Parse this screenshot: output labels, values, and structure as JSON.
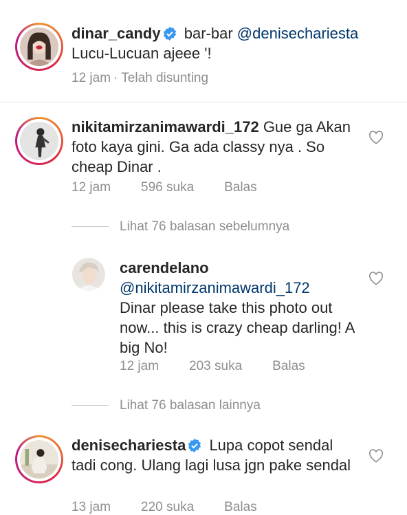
{
  "comments": [
    {
      "username": "dinar_candy",
      "verified": true,
      "text_part1": "bar-bar ",
      "mention": "@denisechariesta",
      "text_part2": "Lucu-Lucuan ajeee '!",
      "time": "12 jam",
      "edited": "· Telah disunting"
    },
    {
      "username": "nikitamirzanimawardi_172",
      "text": "Gue ga Akan foto kaya gini. Ga ada classy nya . So cheap Dinar .",
      "time": "12 jam",
      "likes": "596 suka",
      "reply": "Balas"
    },
    {
      "username": "carendelano",
      "mention": "@nikitamirzanimawardi_172",
      "text": "Dinar please take this photo out now... this is crazy cheap darling! A big No!",
      "time": "12 jam",
      "likes": "203 suka",
      "reply": "Balas"
    },
    {
      "username": "denisechariesta",
      "verified": true,
      "text": "Lupa copot sendal tadi cong. Ulang lagi lusa jgn pake sendal",
      "time": "13 jam",
      "likes": "220 suka",
      "reply": "Balas"
    }
  ],
  "view_previous_replies": "Lihat 76 balasan sebelumnya",
  "view_more_replies": "Lihat 76 balasan lainnya",
  "colors": {
    "accent_mention": "#00376b",
    "verified": "#3897f0",
    "meta": "#8e8e8e"
  },
  "icons": [
    "verified-badge-icon",
    "heart-icon"
  ]
}
